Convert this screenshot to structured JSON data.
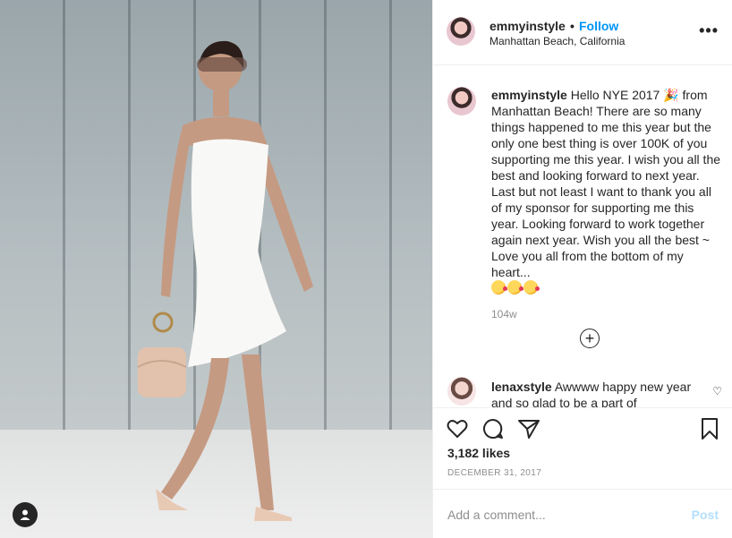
{
  "post": {
    "username": "emmyinstyle",
    "follow_separator": "•",
    "follow_label": "Follow",
    "location": "Manhattan Beach, California",
    "more_label": "•••"
  },
  "caption": {
    "username": "emmyinstyle",
    "text": "Hello NYE 2017 🎉 from Manhattan Beach! There are so many things happened to me this year but the only one best thing is over 100K of you supporting me this year. I wish you all the best and looking forward to next year. Last but not least I want to thank you all of my sponsor for supporting me this year. Looking forward to work together again next year. Wish you all the best ~ Love you all from the bottom of my heart...",
    "time": "104w"
  },
  "reply": {
    "username": "lenaxstyle",
    "text": "Awwww happy new year and so glad to be a part of"
  },
  "actions": {
    "likes": "3,182 likes",
    "date": "DECEMBER 31, 2017"
  },
  "comment_box": {
    "placeholder": "Add a comment...",
    "post_label": "Post"
  },
  "colors": {
    "accent": "#0095f6",
    "post_disabled": "#b2dffc",
    "border": "#efefef",
    "muted": "#8e8e8e"
  }
}
